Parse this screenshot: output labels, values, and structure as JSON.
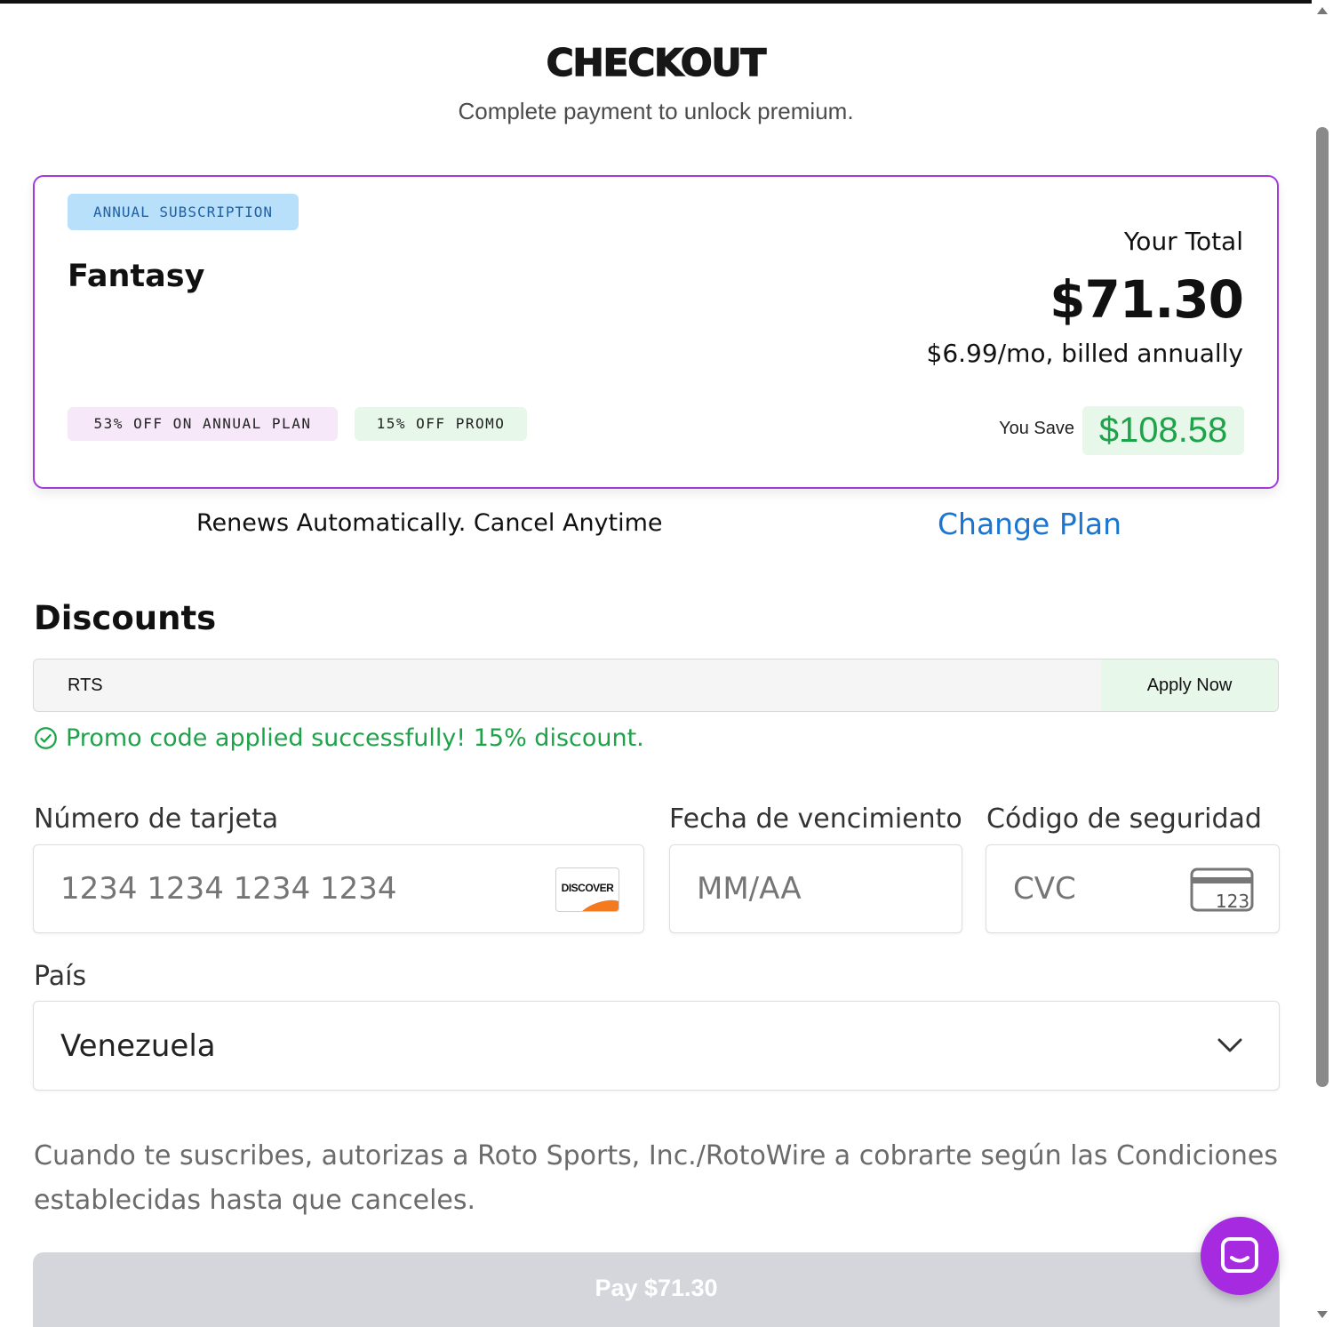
{
  "header": {
    "title": "CHECKOUT",
    "subtitle": "Complete payment to unlock premium."
  },
  "plan": {
    "badge": "ANNUAL SUBSCRIPTION",
    "name": "Fantasy",
    "discount_badges": [
      "53% OFF ON ANNUAL PLAN",
      "15% OFF PROMO"
    ],
    "total_label": "Your Total",
    "total_amount": "$71.30",
    "billing_note": "$6.99/mo, billed annually",
    "you_save_label": "You Save",
    "save_amount": "$108.58"
  },
  "renewal": {
    "note": "Renews Automatically. Cancel Anytime",
    "change_plan_label": "Change Plan"
  },
  "discounts": {
    "heading": "Discounts",
    "promo_code_value": "RTS",
    "apply_label": "Apply Now",
    "success_message": "Promo code applied successfully! 15% discount."
  },
  "payment": {
    "card_number_label": "Número de tarjeta",
    "card_number_placeholder": "1234 1234 1234 1234",
    "card_brand_icon": "discover-card-icon",
    "card_brand_text": "DISCOVER",
    "expiry_label": "Fecha de vencimiento",
    "expiry_placeholder": "MM/AA",
    "cvc_label": "Código de seguridad",
    "cvc_placeholder": "CVC",
    "cvc_icon_text": "123",
    "country_label": "País",
    "country_value": "Venezuela"
  },
  "terms": "Cuando te suscribes, autorizas a Roto Sports, Inc./RotoWire a cobrarte según las Condiciones establecidas hasta que canceles.",
  "pay_button_label": "Pay $71.30",
  "colors": {
    "accent_purple": "#a63ad9",
    "link_blue": "#1a76d2",
    "success_green": "#1fa34a",
    "chat_purple": "#a62be0",
    "pay_button_disabled": "#d4d6dc"
  }
}
